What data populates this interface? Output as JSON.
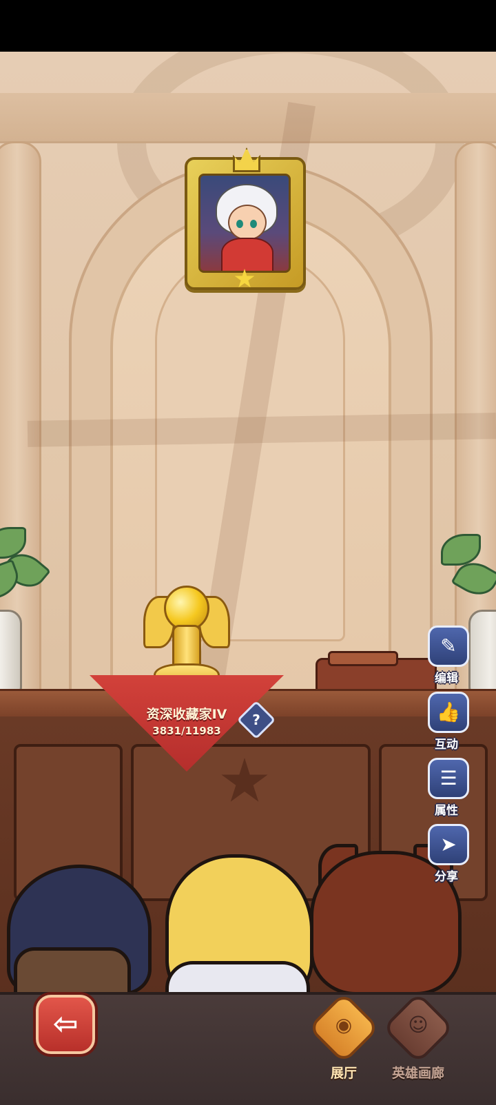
{
  "trophy": {
    "title": "资深收藏家IV",
    "progress_text": "3831/11983",
    "progress_current": 3831,
    "progress_total": 11983
  },
  "help": {
    "label": "?"
  },
  "side_actions": [
    {
      "id": "edit",
      "label": "编辑",
      "icon": "edit-icon",
      "glyph": "✎"
    },
    {
      "id": "interact",
      "label": "互动",
      "icon": "thumbs-up-icon",
      "glyph": "👍"
    },
    {
      "id": "attributes",
      "label": "属性",
      "icon": "list-icon",
      "glyph": "☰"
    },
    {
      "id": "share",
      "label": "分享",
      "icon": "paper-plane-icon",
      "glyph": "➤"
    }
  ],
  "back": {
    "glyph": "⇦",
    "icon": "back-arrow-icon"
  },
  "nav": {
    "tabs": [
      {
        "label": "展厅",
        "active": true,
        "icon": "exhibition-hall-icon",
        "glyph": "◉"
      },
      {
        "label": "英雄画廊",
        "active": false,
        "icon": "hero-gallery-icon",
        "glyph": "☺"
      }
    ]
  },
  "colors": {
    "banner_red": "#c8383a",
    "side_button_blue": "#3f5596",
    "active_tab": "#e59a36",
    "back_button_red": "#d0443a"
  }
}
